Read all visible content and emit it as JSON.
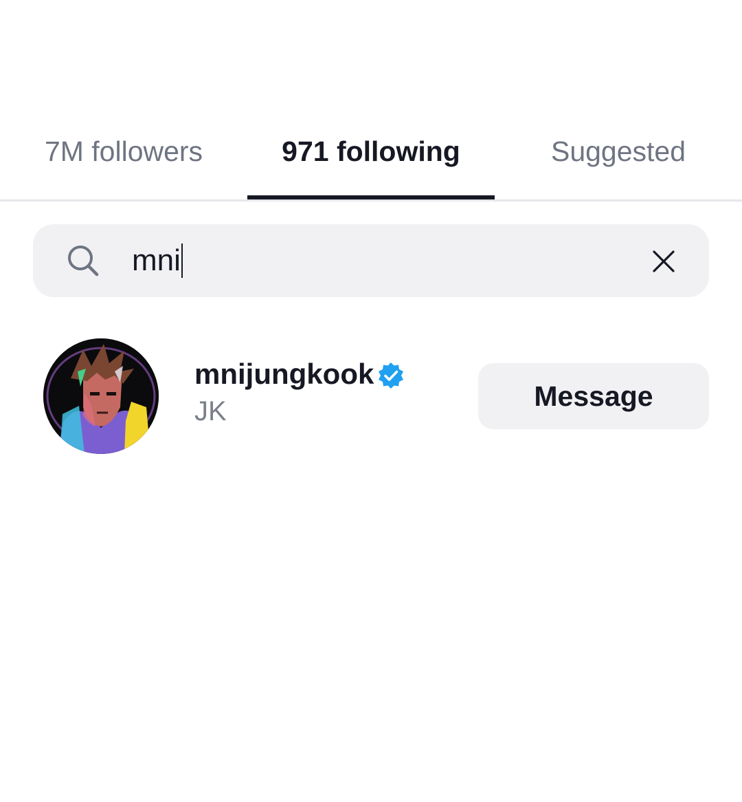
{
  "tabs": [
    {
      "label": "7M followers",
      "active": false
    },
    {
      "label": "971 following",
      "active": true
    },
    {
      "label": "Suggested",
      "active": false
    }
  ],
  "search": {
    "value": "mni",
    "icon": "search-icon",
    "clear_icon": "close-icon"
  },
  "results": [
    {
      "username": "mnijungkook",
      "verified": true,
      "display_name": "JK",
      "action_label": "Message"
    }
  ],
  "colors": {
    "active_text": "#161823",
    "inactive_text": "#6e7481",
    "verified_badge": "#20a0f0",
    "field_background": "#f1f1f4"
  }
}
